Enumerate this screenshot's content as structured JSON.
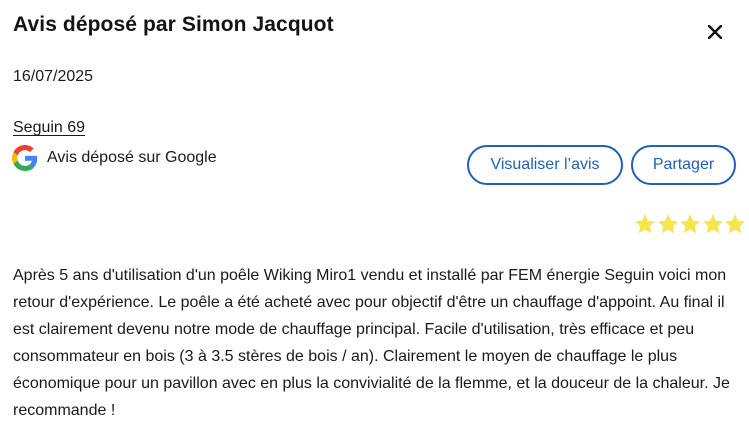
{
  "dialog": {
    "title": "Avis déposé par Simon Jacquot",
    "date": "16/07/2025",
    "business_name": "Seguin 69",
    "source_label": "Avis déposé sur Google",
    "source_icon": "google-icon",
    "close_icon": "close-icon",
    "buttons": {
      "view_label": "Visualiser l’avis",
      "share_label": "Partager"
    },
    "rating": {
      "value": 5,
      "max": 5,
      "star_color": "#f5e44a"
    },
    "review_text": "Après 5 ans d'utilisation d'un poêle Wiking Miro1 vendu et installé par FEM énergie Seguin voici mon retour d'expérience. Le poêle a été acheté avec pour objectif d'être un chauffage d'appoint. Au final il est clairement devenu notre mode de chauffage principal. Facile d'utilisation, très efficace et peu consommateur en bois (3 à 3.5 stères de bois / an). Clairement le moyen de chauffage le plus économique pour un pavillon avec en plus la convivialité de la flemme, et la douceur de la chaleur. Je recommande !",
    "accent_color": "#1f5fbf"
  }
}
